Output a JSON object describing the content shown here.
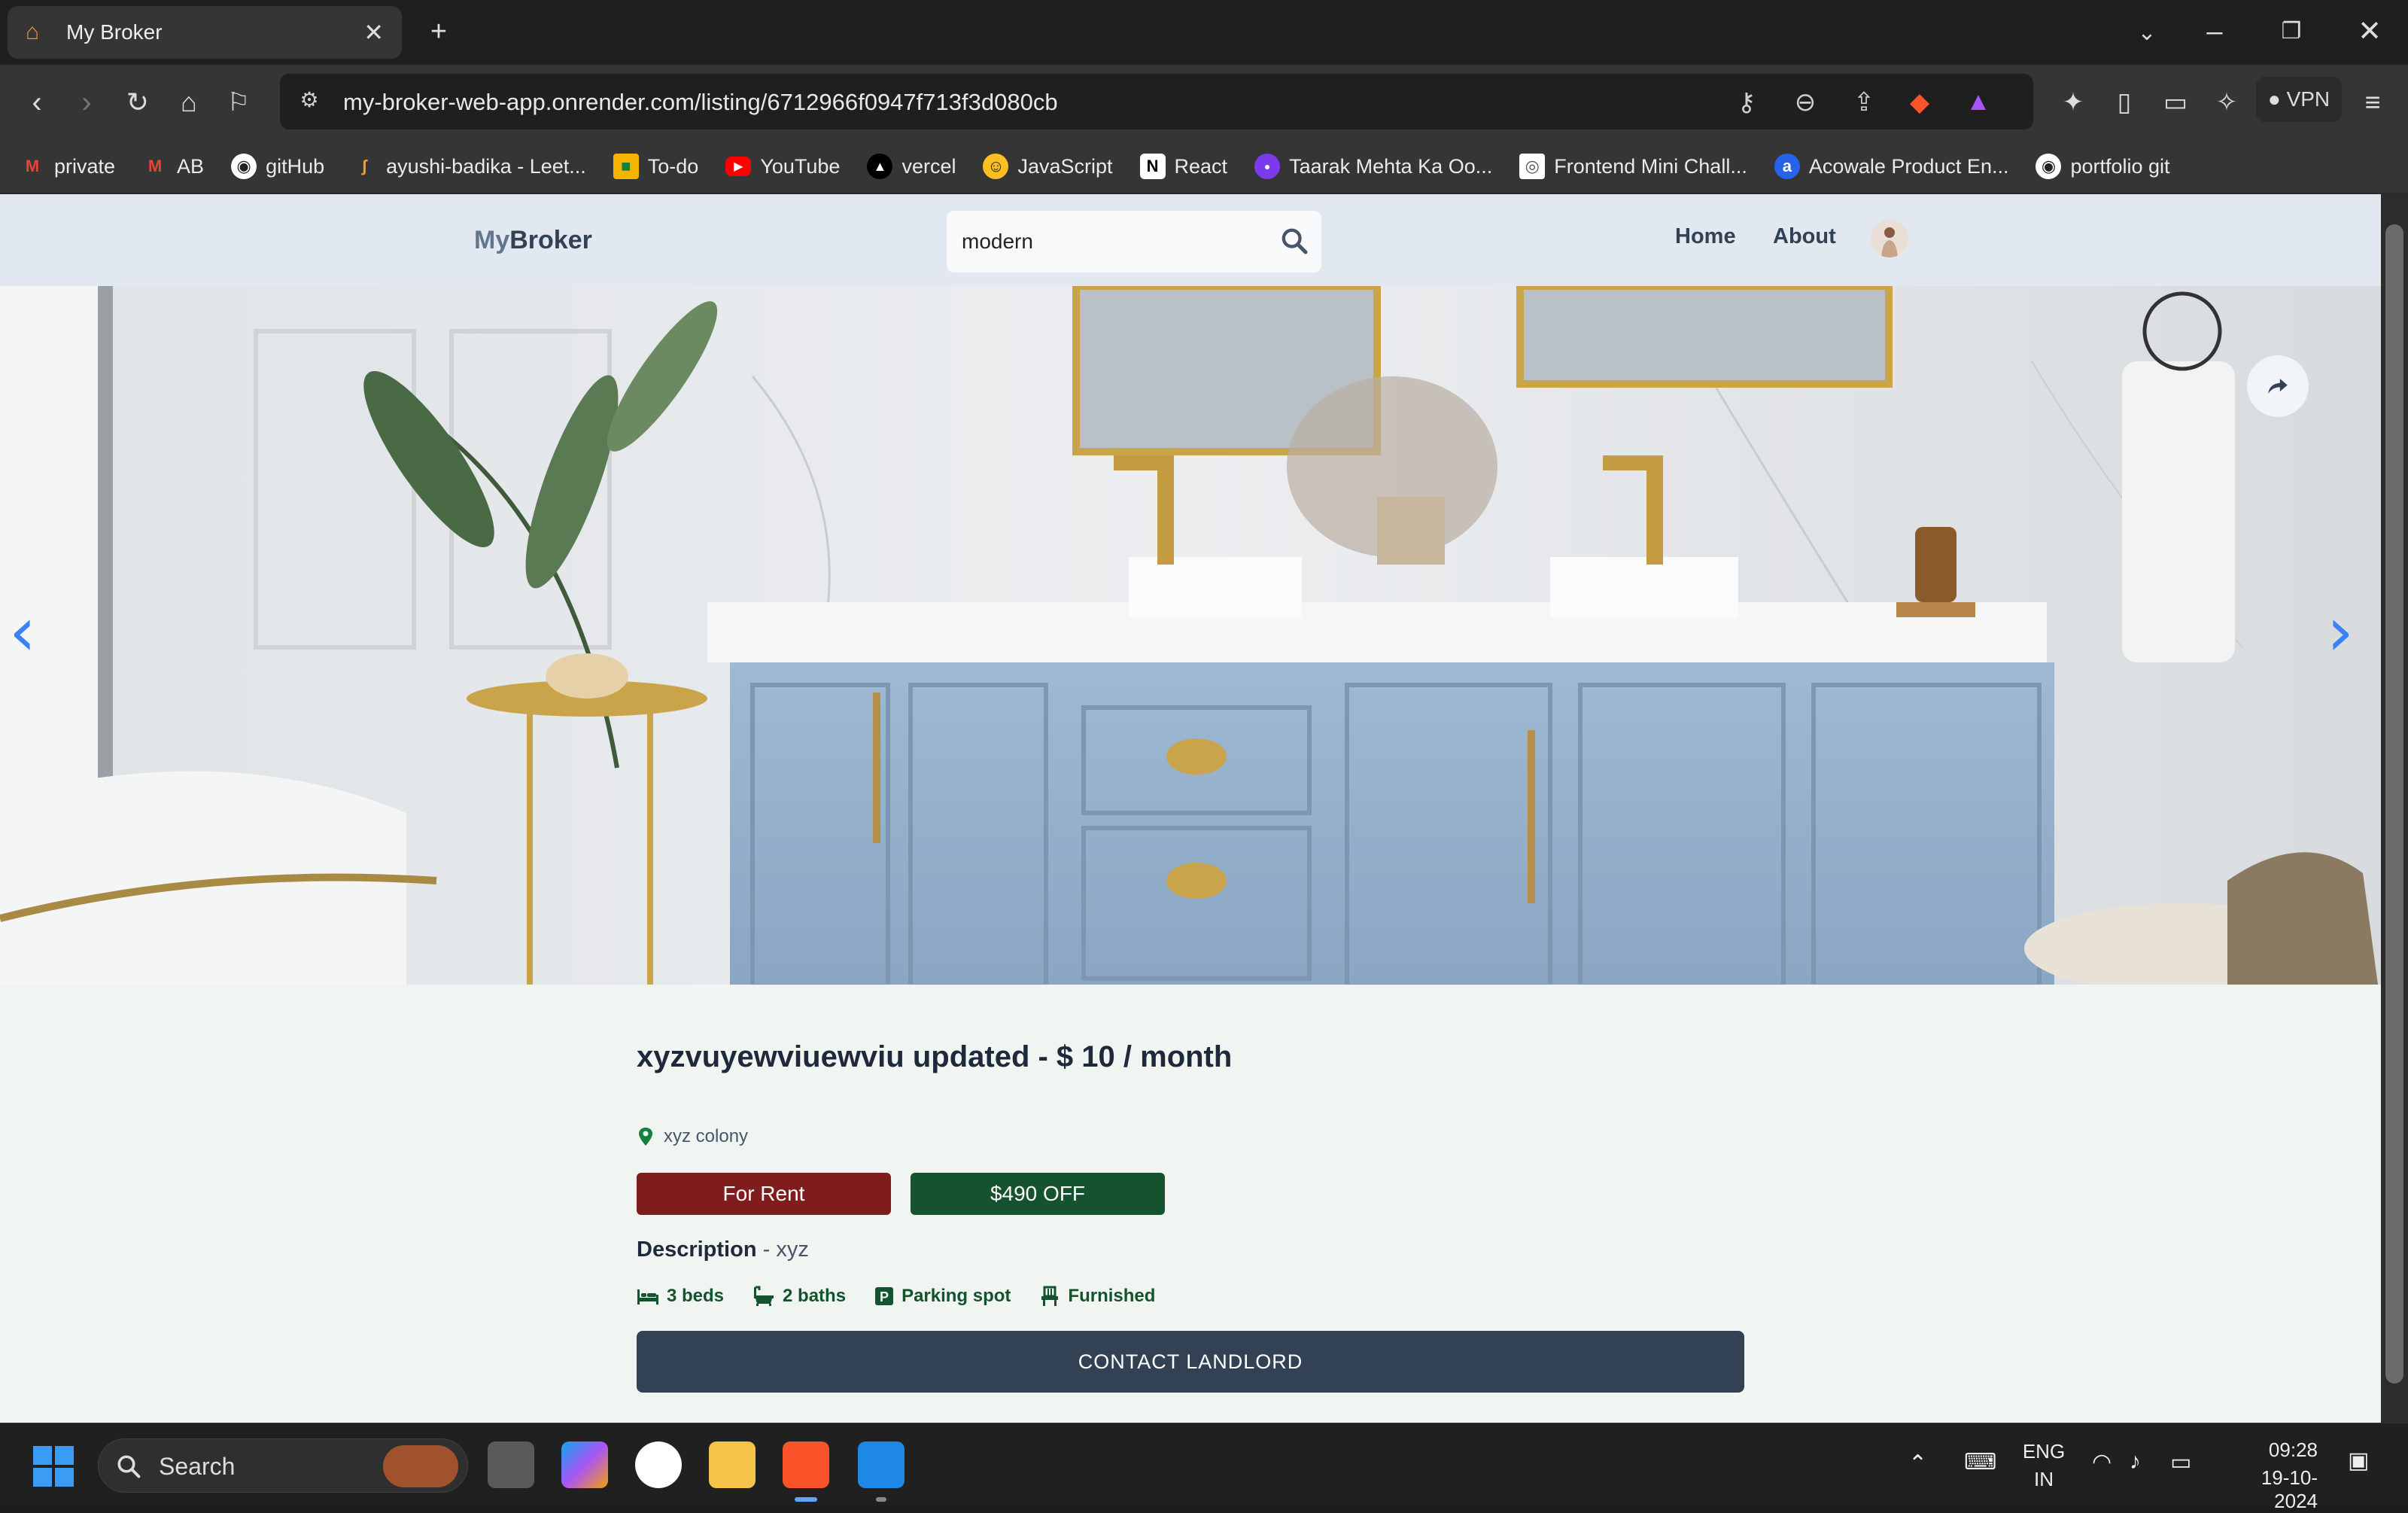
{
  "browser": {
    "tab_title": "My Broker",
    "url": "my-broker-web-app.onrender.com/listing/6712966f0947f713f3d080cb",
    "vpn_label": "VPN",
    "bookmarks": [
      {
        "label": "private",
        "icon": "gmail-icon",
        "color": "#ea4335"
      },
      {
        "label": "AB",
        "icon": "gmail-icon",
        "color": "#ea4335"
      },
      {
        "label": "gitHub",
        "icon": "github-icon",
        "color": "#ffffff"
      },
      {
        "label": "ayushi-badika - Leet...",
        "icon": "leetcode-icon",
        "color": "#f89f1b"
      },
      {
        "label": "To-do",
        "icon": "classroom-icon",
        "color": "#f4b400"
      },
      {
        "label": "YouTube",
        "icon": "youtube-icon",
        "color": "#ff0000"
      },
      {
        "label": "vercel",
        "icon": "vercel-icon",
        "color": "#000000"
      },
      {
        "label": "JavaScript",
        "icon": "emoji-icon",
        "color": "#fbbf24"
      },
      {
        "label": "React",
        "icon": "notion-icon",
        "color": "#ffffff"
      },
      {
        "label": "Taarak Mehta Ka Oo...",
        "icon": "sonyliv-icon",
        "color": "#7c3aed"
      },
      {
        "label": "Frontend Mini Chall...",
        "icon": "page-icon",
        "color": "#ffffff"
      },
      {
        "label": "Acowale Product En...",
        "icon": "acowale-icon",
        "color": "#2563eb"
      },
      {
        "label": "portfolio git",
        "icon": "github-icon",
        "color": "#ffffff"
      }
    ]
  },
  "site": {
    "logo_part1": "My",
    "logo_part2": "Broker",
    "search_value": "modern",
    "nav": {
      "home": "Home",
      "about": "About"
    }
  },
  "listing": {
    "title": "xyzvuyewviuewviu updated - $ 10 / month",
    "address": "xyz colony",
    "type_badge": "For Rent",
    "discount_badge": "$490 OFF",
    "description_label": "Description",
    "description_value": "xyz",
    "features": {
      "beds": "3 beds",
      "baths": "2 baths",
      "parking": "Parking spot",
      "furnished": "Furnished"
    },
    "contact_button": "CONTACT LANDLORD",
    "colors": {
      "rent": "#7f1d1d",
      "discount": "#14532d",
      "contact": "#334155"
    }
  },
  "taskbar": {
    "search_label": "Search",
    "lang_line1": "ENG",
    "lang_line2": "IN",
    "time": "09:28",
    "date": "19-10-2024"
  }
}
